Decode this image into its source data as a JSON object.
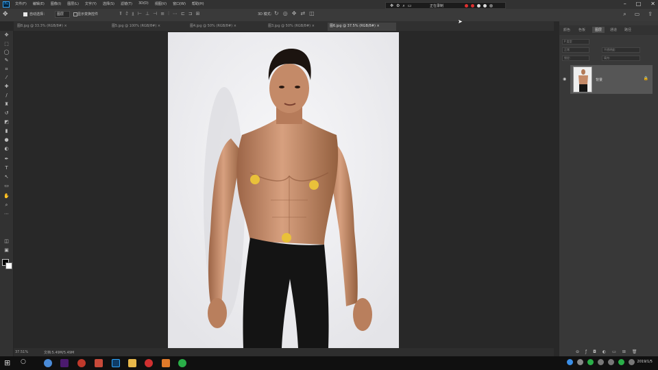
{
  "menubar": {
    "logo": "Ps",
    "items": [
      "文件(F)",
      "编辑(E)",
      "图像(I)",
      "图层(L)",
      "文字(Y)",
      "选择(S)",
      "滤镜(T)",
      "3D(D)",
      "视图(V)",
      "窗口(W)",
      "帮助(H)"
    ],
    "window_controls": [
      "–",
      "□",
      "✕"
    ]
  },
  "recording_bar": {
    "title": "正在录制"
  },
  "options_bar": {
    "auto_select_label": "自动选择：",
    "auto_select_value": "图层",
    "transform_label": "显示变换控件",
    "mode_label": "3D 模式："
  },
  "tabs": [
    {
      "label": "图8.jpg @ 33.3% (RGB/8#) ×"
    },
    {
      "label": "图5.jpg @ 100% (RGB/8#) ×"
    },
    {
      "label": "图4.jpg @ 50% (RGB/8#) ×"
    },
    {
      "label": "图3.jpg @ 50% (RGB/8#) ×"
    },
    {
      "label": "图6.jpg @ 37.5% (RGB/8#) ×"
    }
  ],
  "status": {
    "zoom": "37.51%",
    "doc": "文档:5.49M/5.49M"
  },
  "panel": {
    "tabs": [
      "颜色",
      "色板",
      "图层",
      "通道",
      "路径"
    ],
    "search_placeholder": "P 类型",
    "blend_mode": "正常",
    "opacity_label": "不透明度:",
    "lock_label": "锁定:",
    "fill_label": "填充:",
    "layer_name": "背景"
  },
  "taskbar": {
    "time": "2019/1/5"
  },
  "colors": {
    "accent": "#31a8ff",
    "record_red": "#e03030",
    "ui_dark": "#282828"
  }
}
